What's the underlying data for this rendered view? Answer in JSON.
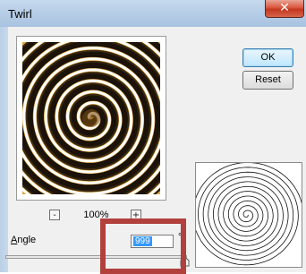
{
  "dialog": {
    "title": "Twirl",
    "close_glyph": "✕"
  },
  "preview": {
    "zoom_level": "100%",
    "zoom_out_label": "-",
    "zoom_in_label": "+"
  },
  "buttons": {
    "ok_label": "OK",
    "reset_label": "Reset"
  },
  "angle": {
    "label_accel": "A",
    "label_rest": "ngle",
    "value": "999",
    "unit": "°",
    "slider_fraction": 1.0
  },
  "colors": {
    "accent_highlight": "#b2403c",
    "selection": "#3399ff",
    "twirl_gold": "#e7a536",
    "twirl_dark": "#1b1209"
  }
}
